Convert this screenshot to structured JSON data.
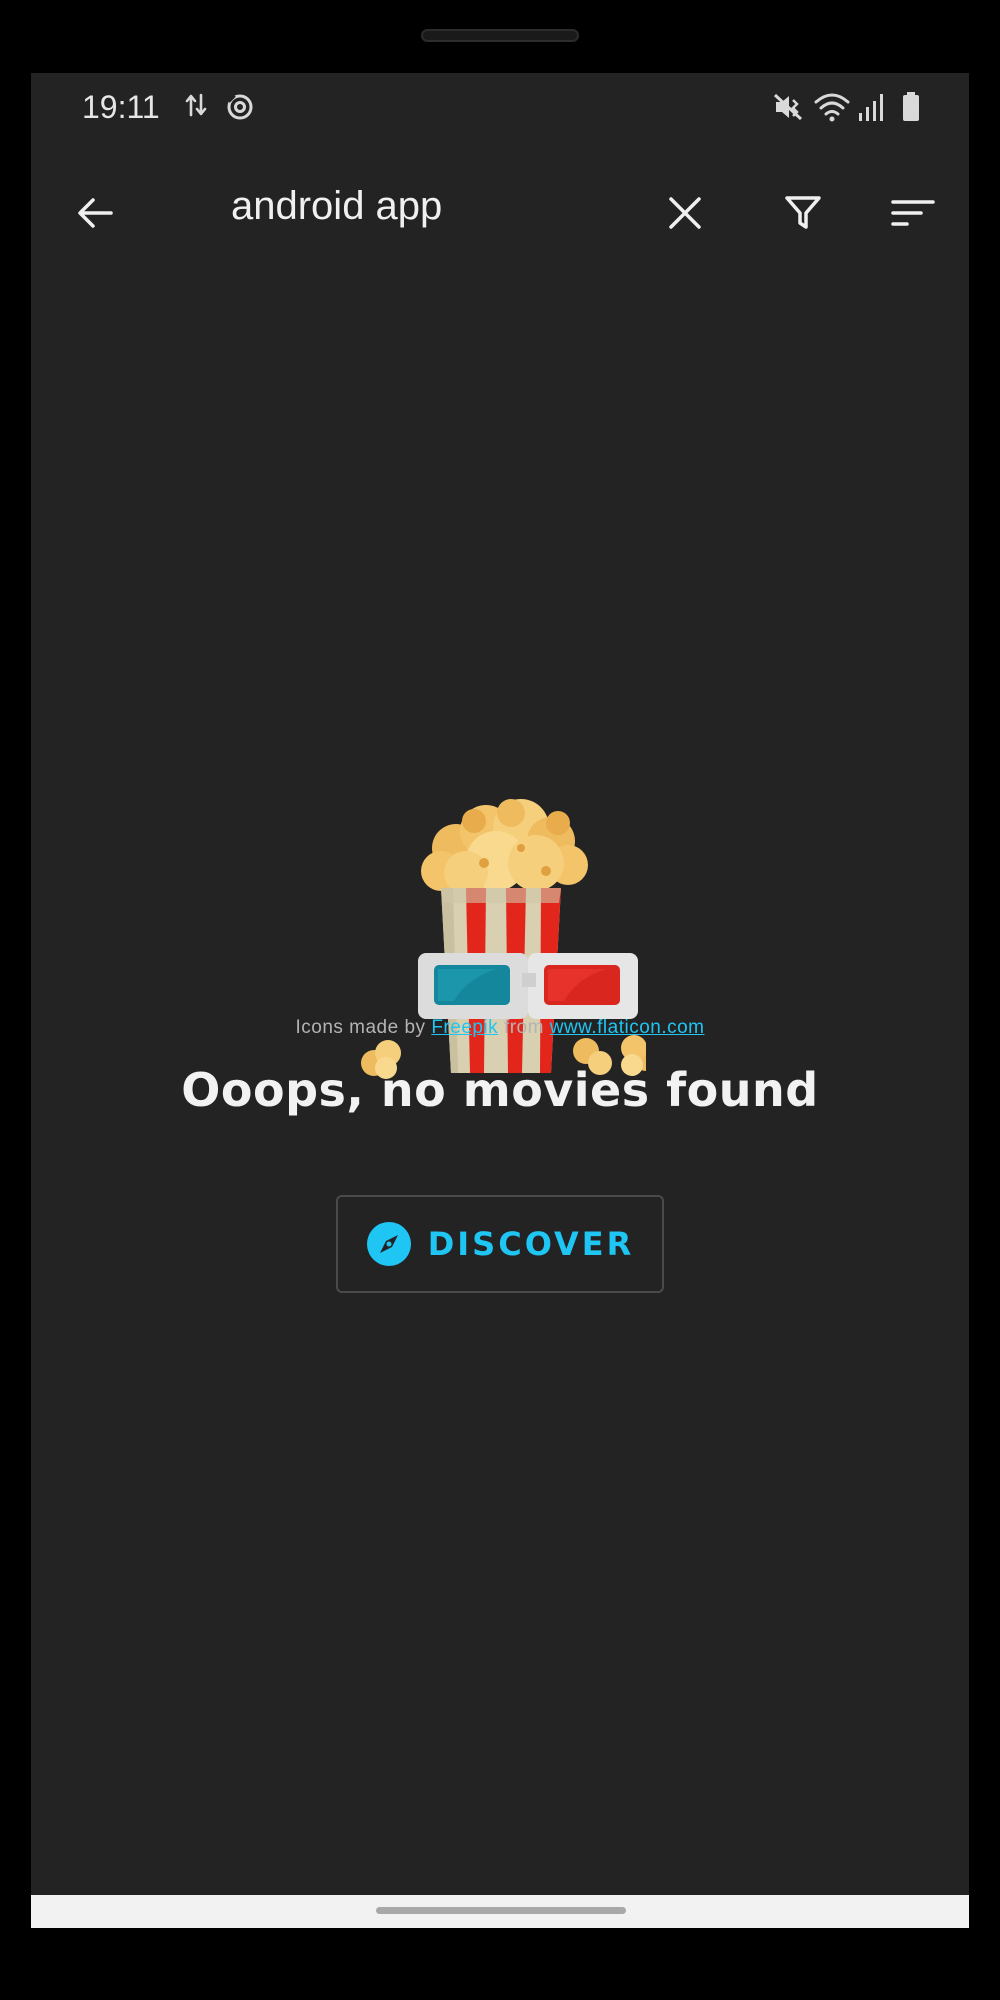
{
  "status_bar": {
    "time": "19:11"
  },
  "app_bar": {
    "search_query": "android app"
  },
  "empty_state": {
    "credit_prefix": "Icons made by ",
    "credit_author": "Freepik",
    "credit_middle": " from ",
    "credit_site": "www.flaticon.com",
    "title": "Ooops, no movies found",
    "button_label": "DISCOVER"
  },
  "colors": {
    "background": "#232323",
    "accent": "#1fc6f4",
    "text_primary": "#f2f2f2",
    "text_secondary": "#b3b3b3"
  },
  "icons": {
    "back": "arrow-left-icon",
    "clear": "close-icon",
    "filter": "filter-icon",
    "sort": "sort-icon",
    "discover": "compass-icon"
  }
}
